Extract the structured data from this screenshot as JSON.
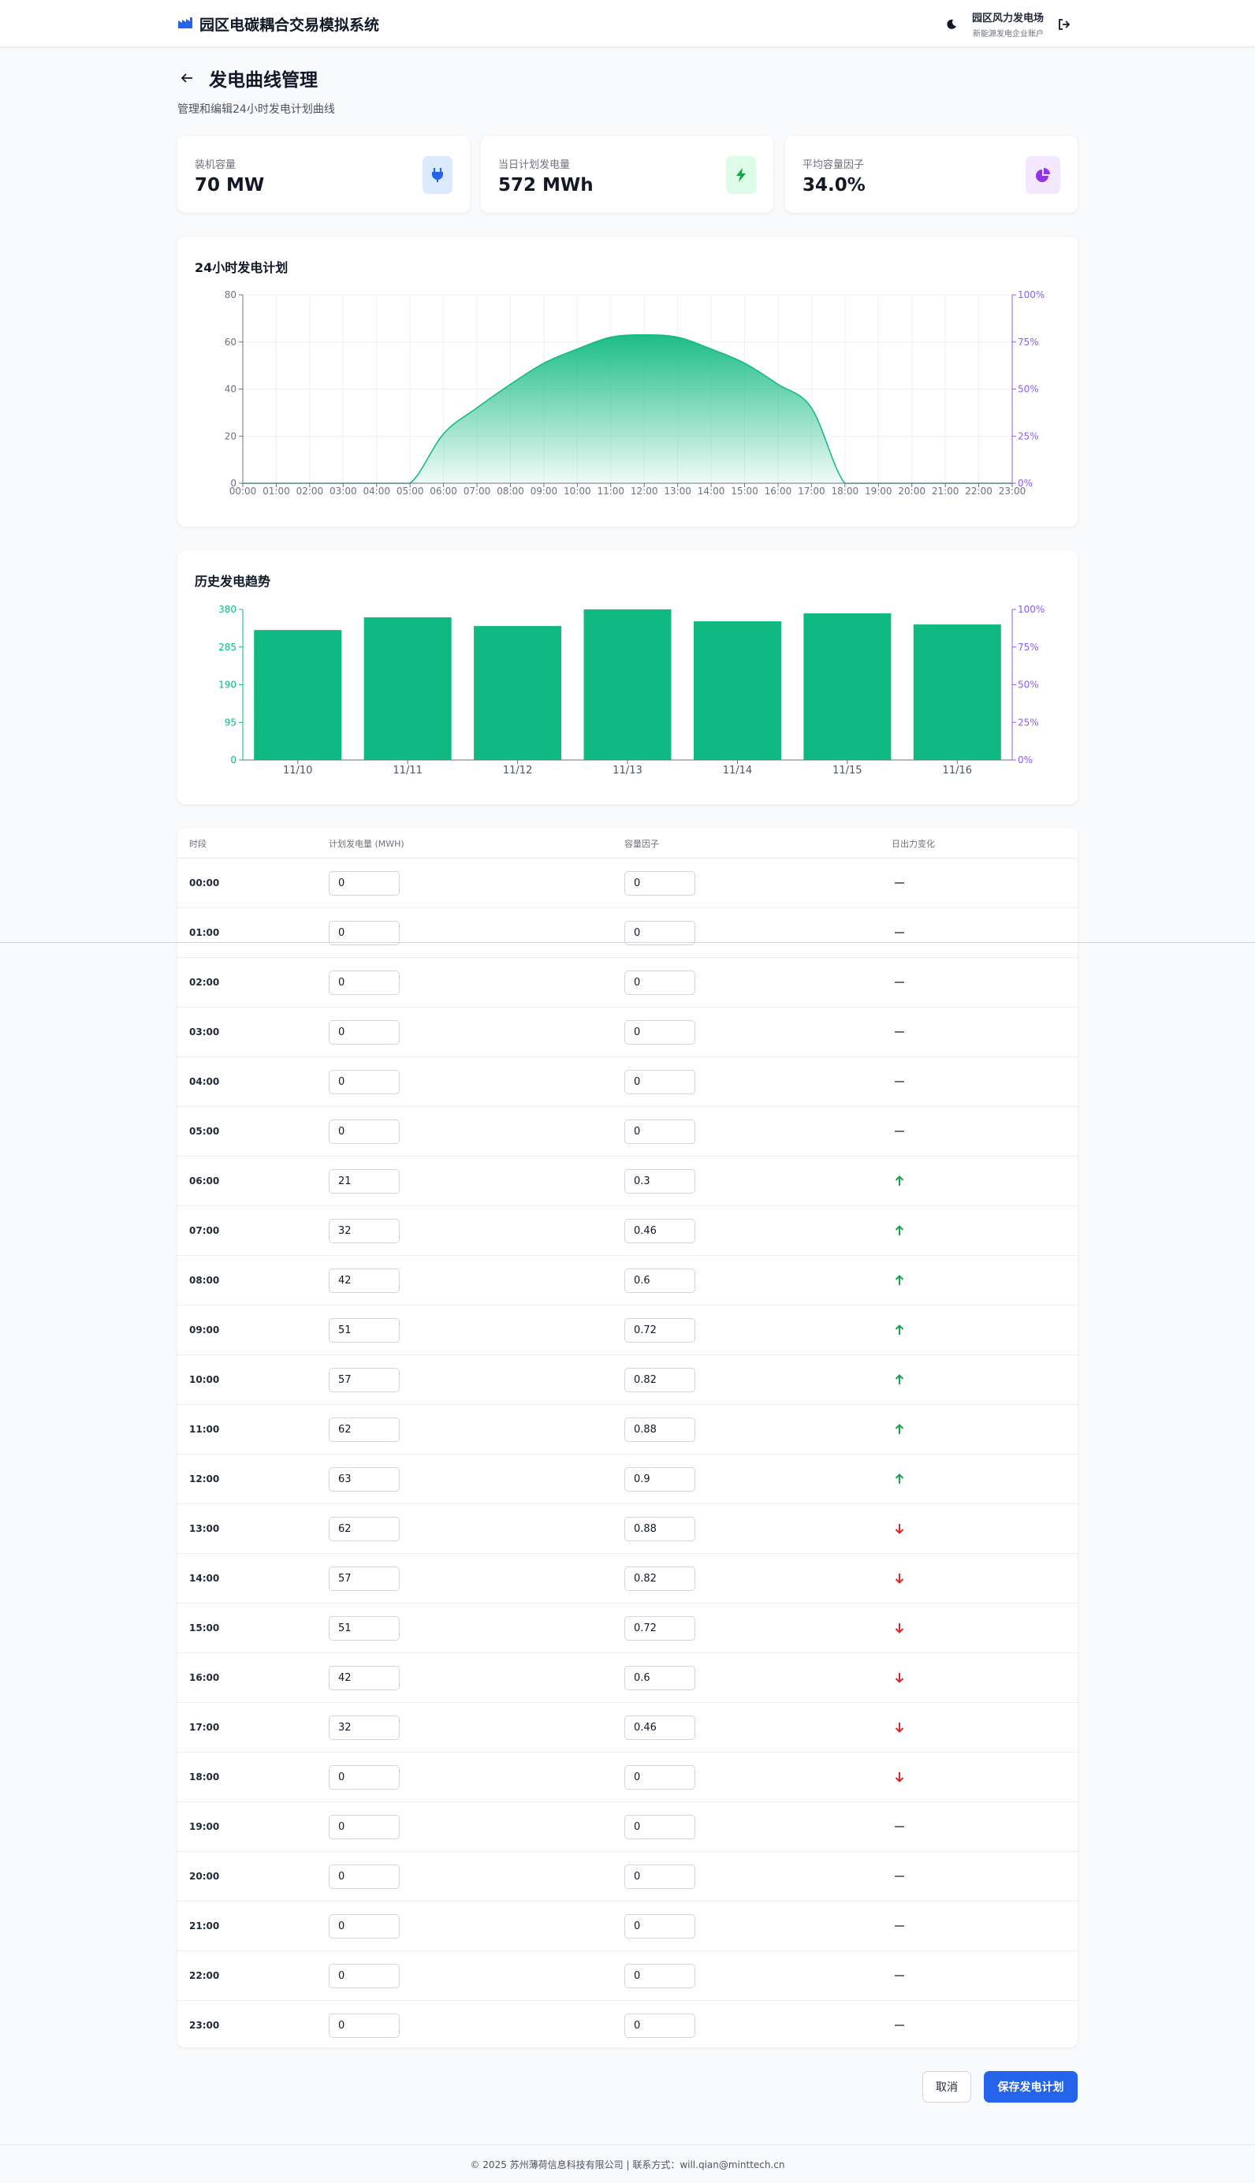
{
  "app": {
    "title": "园区电碳耦合交易模拟系统",
    "user_name": "园区风力发电场",
    "user_role": "新能源发电企业账户"
  },
  "page": {
    "title": "发电曲线管理",
    "subtitle": "管理和编辑24小时发电计划曲线"
  },
  "stats": [
    {
      "label": "装机容量",
      "value": "70 MW",
      "icon": "plug-icon",
      "color": "#2563eb",
      "bg": "#dbeafe"
    },
    {
      "label": "当日计划发电量",
      "value": "572 MWh",
      "icon": "bolt-icon",
      "color": "#16a34a",
      "bg": "#dcfce7"
    },
    {
      "label": "平均容量因子",
      "value": "34.0%",
      "icon": "pie-icon",
      "color": "#9333ea",
      "bg": "#f3e8ff"
    }
  ],
  "colors": {
    "accent": "#10b981",
    "purple_axis": "#8b5cf6",
    "up": "#16a34a",
    "down": "#dc2626",
    "primary": "#2563eb"
  },
  "chart_data": [
    {
      "type": "area",
      "title": "24小时发电计划",
      "x": [
        "00:00",
        "01:00",
        "02:00",
        "03:00",
        "04:00",
        "05:00",
        "06:00",
        "07:00",
        "08:00",
        "09:00",
        "10:00",
        "11:00",
        "12:00",
        "13:00",
        "14:00",
        "15:00",
        "16:00",
        "17:00",
        "18:00",
        "19:00",
        "20:00",
        "21:00",
        "22:00",
        "23:00"
      ],
      "values": [
        0,
        0,
        0,
        0,
        0,
        0,
        21,
        32,
        42,
        51,
        57,
        62,
        63,
        62,
        57,
        51,
        42,
        32,
        0,
        0,
        0,
        0,
        0,
        0
      ],
      "ylim": [
        0,
        80
      ],
      "yticks": [
        "0",
        "20",
        "40",
        "60",
        "80"
      ],
      "y2ticks": [
        "0%",
        "25%",
        "50%",
        "75%",
        "100%"
      ],
      "grid": true
    },
    {
      "type": "bar",
      "title": "历史发电趋势",
      "categories": [
        "11/10",
        "11/11",
        "11/12",
        "11/13",
        "11/14",
        "11/15",
        "11/16"
      ],
      "values": [
        328,
        360,
        338,
        380,
        350,
        370,
        342
      ],
      "ylim": [
        0,
        380
      ],
      "yticks": [
        "0",
        "95",
        "190",
        "285",
        "380"
      ],
      "y2ticks": [
        "0%",
        "25%",
        "50%",
        "75%",
        "100%"
      ],
      "grid": false
    }
  ],
  "table": {
    "headers": [
      "时段",
      "计划发电量 (MWH)",
      "容量因子",
      "日出力变化"
    ],
    "rows": [
      {
        "time": "00:00",
        "gen": "0",
        "cf": "0",
        "trend": "flat"
      },
      {
        "time": "01:00",
        "gen": "0",
        "cf": "0",
        "trend": "flat"
      },
      {
        "time": "02:00",
        "gen": "0",
        "cf": "0",
        "trend": "flat"
      },
      {
        "time": "03:00",
        "gen": "0",
        "cf": "0",
        "trend": "flat"
      },
      {
        "time": "04:00",
        "gen": "0",
        "cf": "0",
        "trend": "flat"
      },
      {
        "time": "05:00",
        "gen": "0",
        "cf": "0",
        "trend": "flat"
      },
      {
        "time": "06:00",
        "gen": "21",
        "cf": "0.3",
        "trend": "up"
      },
      {
        "time": "07:00",
        "gen": "32",
        "cf": "0.46",
        "trend": "up"
      },
      {
        "time": "08:00",
        "gen": "42",
        "cf": "0.6",
        "trend": "up"
      },
      {
        "time": "09:00",
        "gen": "51",
        "cf": "0.72",
        "trend": "up"
      },
      {
        "time": "10:00",
        "gen": "57",
        "cf": "0.82",
        "trend": "up"
      },
      {
        "time": "11:00",
        "gen": "62",
        "cf": "0.88",
        "trend": "up"
      },
      {
        "time": "12:00",
        "gen": "63",
        "cf": "0.9",
        "trend": "up"
      },
      {
        "time": "13:00",
        "gen": "62",
        "cf": "0.88",
        "trend": "down"
      },
      {
        "time": "14:00",
        "gen": "57",
        "cf": "0.82",
        "trend": "down"
      },
      {
        "time": "15:00",
        "gen": "51",
        "cf": "0.72",
        "trend": "down"
      },
      {
        "time": "16:00",
        "gen": "42",
        "cf": "0.6",
        "trend": "down"
      },
      {
        "time": "17:00",
        "gen": "32",
        "cf": "0.46",
        "trend": "down"
      },
      {
        "time": "18:00",
        "gen": "0",
        "cf": "0",
        "trend": "down"
      },
      {
        "time": "19:00",
        "gen": "0",
        "cf": "0",
        "trend": "flat"
      },
      {
        "time": "20:00",
        "gen": "0",
        "cf": "0",
        "trend": "flat"
      },
      {
        "time": "21:00",
        "gen": "0",
        "cf": "0",
        "trend": "flat"
      },
      {
        "time": "22:00",
        "gen": "0",
        "cf": "0",
        "trend": "flat"
      },
      {
        "time": "23:00",
        "gen": "0",
        "cf": "0",
        "trend": "flat"
      }
    ]
  },
  "actions": {
    "cancel": "取消",
    "save": "保存发电计划"
  },
  "footer": {
    "text": "© 2025 苏州薄荷信息科技有限公司 | 联系方式：will.qian@minttech.cn"
  }
}
